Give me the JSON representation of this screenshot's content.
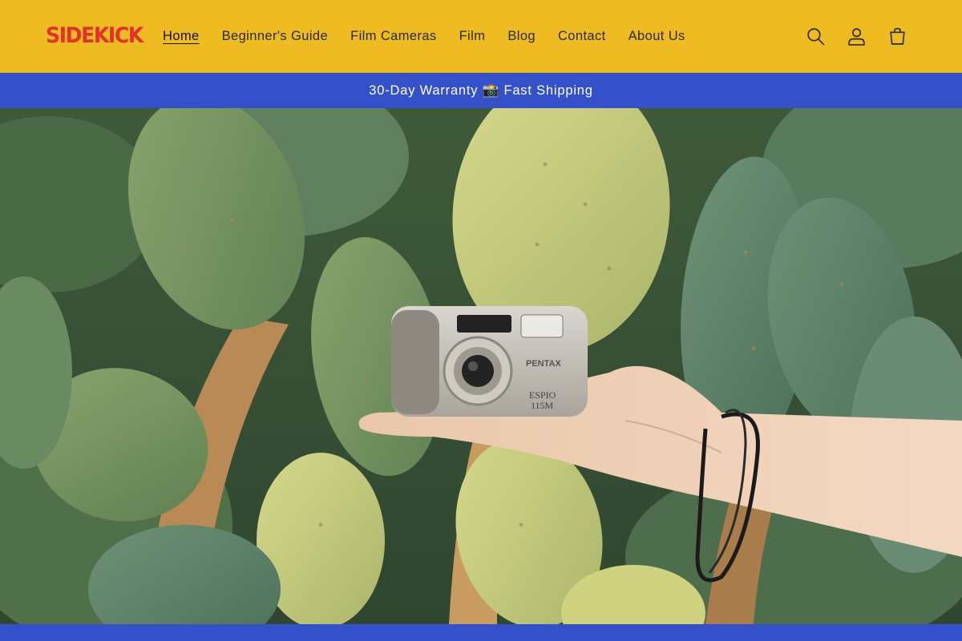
{
  "brand": {
    "logo_text": "SIDEKICK"
  },
  "nav": {
    "items": [
      {
        "label": "Home",
        "active": true
      },
      {
        "label": "Beginner's Guide"
      },
      {
        "label": "Film Cameras"
      },
      {
        "label": "Film"
      },
      {
        "label": "Blog"
      },
      {
        "label": "Contact"
      },
      {
        "label": "About Us"
      }
    ]
  },
  "header_icons": [
    "search-icon",
    "account-icon",
    "cart-icon"
  ],
  "announcement": {
    "text": "30-Day Warranty 📸 Fast Shipping"
  },
  "hero": {
    "camera": {
      "brand": "PENTAX",
      "model_line1": "ESPIO",
      "model_line2": "115M"
    }
  },
  "colors": {
    "header_bg": "#efbb22",
    "accent_blue": "#3451c9",
    "logo": "#e3312b"
  }
}
